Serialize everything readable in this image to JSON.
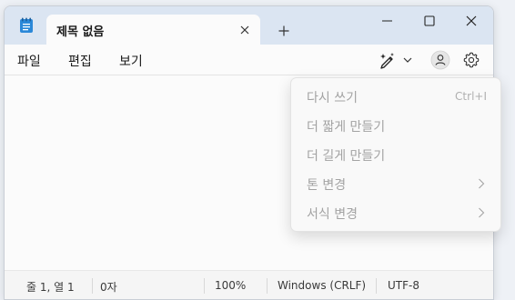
{
  "tab": {
    "title": "제목 없음"
  },
  "menu": {
    "file": "파일",
    "edit": "편집",
    "view": "보기"
  },
  "rewrite_menu": {
    "items": [
      {
        "label": "다시 쓰기",
        "shortcut": "Ctrl+I"
      },
      {
        "label": "더 짧게 만들기"
      },
      {
        "label": "더 길게 만들기"
      },
      {
        "label": "톤 변경",
        "submenu": true
      },
      {
        "label": "서식 변경",
        "submenu": true
      }
    ]
  },
  "status": {
    "position": "줄 1, 열 1",
    "chars": "0자",
    "zoom": "100%",
    "line_ending": "Windows (CRLF)",
    "encoding": "UTF-8"
  },
  "icons": {
    "app": "notepad-icon",
    "ai": "copilot-sparkle-pen-icon",
    "account": "person-icon",
    "settings": "gear-icon"
  },
  "colors": {
    "titlebar": "#dbe5f2",
    "disabled_text": "#a3a3a3",
    "app_icon": "#2b88d8"
  }
}
